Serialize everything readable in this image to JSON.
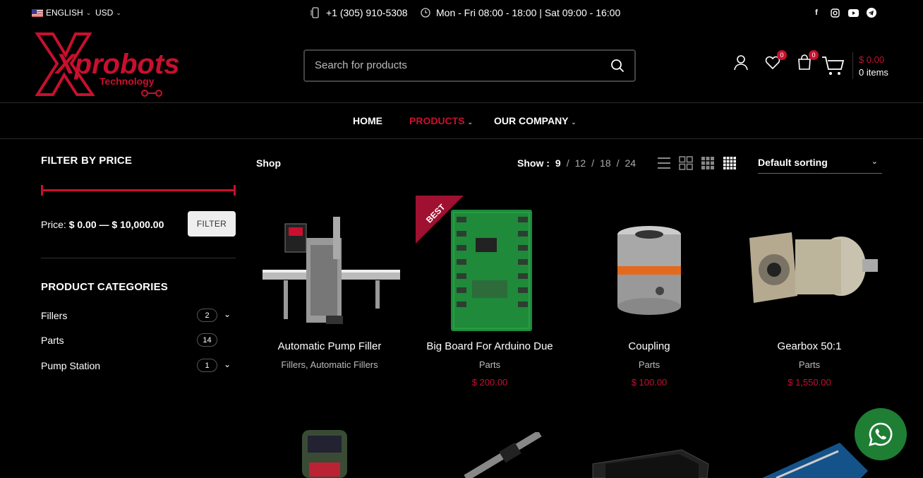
{
  "topbar": {
    "language": "ENGLISH",
    "currency": "USD",
    "phone": "+1 (305) 910-5308",
    "hours": "Mon - Fri 08:00 - 18:00 | Sat 09:00 - 16:00",
    "social_icons": [
      "facebook-icon",
      "instagram-icon",
      "youtube-icon",
      "telegram-icon"
    ]
  },
  "header": {
    "logo_text": "Xprobots",
    "logo_subtext": "Technology",
    "search_placeholder": "Search for products",
    "wishlist_count": "0",
    "compare_count": "0",
    "cart_amount": "$ 0.00",
    "cart_items": "0 items"
  },
  "nav": {
    "items": [
      {
        "label": "HOME"
      },
      {
        "label": "PRODUCTS",
        "active": true
      },
      {
        "label": "OUR COMPANY"
      }
    ]
  },
  "sidebar": {
    "price_heading": "FILTER BY PRICE",
    "price_label": "Price:",
    "price_min": "$ 0.00",
    "price_dash": "—",
    "price_max": "$ 10,000.00",
    "filter_button": "FILTER",
    "categories_heading": "PRODUCT CATEGORIES",
    "categories": [
      {
        "name": "Fillers",
        "count": "2",
        "expandable": true
      },
      {
        "name": "Parts",
        "count": "14",
        "expandable": false
      },
      {
        "name": "Pump Station",
        "count": "1",
        "expandable": true
      }
    ]
  },
  "toolbar": {
    "breadcrumb": "Shop",
    "show_label": "Show :",
    "show_options": [
      "9",
      "12",
      "18",
      "24"
    ],
    "show_selected": "9",
    "sorting": "Default sorting"
  },
  "products": [
    {
      "title": "Automatic Pump Filler",
      "category": "Fillers, Automatic Fillers",
      "price": ""
    },
    {
      "title": "Big Board For Arduino Due",
      "category": "Parts",
      "price": "$ 200.00",
      "badge": "BEST"
    },
    {
      "title": "Coupling",
      "category": "Parts",
      "price": "$ 100.00"
    },
    {
      "title": "Gearbox 50:1",
      "category": "Parts",
      "price": "$ 1,550.00"
    }
  ],
  "colors": {
    "accent": "#c8102e",
    "background": "#000000",
    "whatsapp": "#1e7e34"
  }
}
